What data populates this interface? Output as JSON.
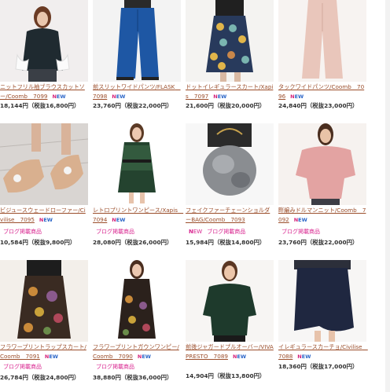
{
  "products": [
    {
      "name": "ニットフリル袖ブラウスカットソー/Coomb　7099",
      "new": "NEW",
      "blog": "",
      "price": "18,144円（税抜16,800円）"
    },
    {
      "name": "前スリットワイドパンツ/FLASK　7098",
      "new": "NEW",
      "blog": "",
      "price": "23,760円（税抜22,000円）"
    },
    {
      "name": "ドットイレギュラースカート/Xapis　7097",
      "new": "NEW",
      "blog": "",
      "price": "21,600円（税抜20,000円）"
    },
    {
      "name": "タックワイドパンツ/Coomb　7096",
      "new": "NEW",
      "blog": "",
      "price": "24,840円（税抜23,000円）"
    },
    {
      "name": "ビジュースウェードローファー/Civilise　7095",
      "new": "NEW",
      "blog": "ブログ掲載商品",
      "price": "10,584円（税抜9,800円）"
    },
    {
      "name": "レトロプリントワンピース/Xapis　7094",
      "new": "NEW",
      "blog": "ブログ掲載商品",
      "price": "28,080円（税抜26,000円）"
    },
    {
      "name": "フェイクファーチェーンショルダーBAG/Coomb　7093",
      "new": "NEW",
      "blog": "ブログ掲載商品",
      "price": "15,984円（税抜14,800円）"
    },
    {
      "name": "畔編みドルマンニット/Coomb　7092",
      "new": "NEW",
      "blog": "ブログ掲載商品",
      "price": "23,760円（税抜22,000円）"
    },
    {
      "name": "フラワープリントラップスカート/Coomb　7091",
      "new": "NEW",
      "blog": "ブログ掲載商品",
      "price": "26,784円（税抜24,800円）"
    },
    {
      "name": "フラワープリントガウンワンピー/Coomb　7090",
      "new": "NEW",
      "blog": "ブログ掲載商品",
      "price": "38,880円（税抜36,000円）"
    },
    {
      "name": "前後ジャガードプルオーバー/VIVA PRESTO　7089",
      "new": "NEW",
      "blog": "",
      "price": "14,904円（税抜13,800円）"
    },
    {
      "name": "イレギュラースカーチョ/Civilise　7088",
      "new": "NEW",
      "blog": "",
      "price": "18,360円（税抜17,000円）"
    }
  ],
  "colors": {
    "link": "#9b4e2b",
    "blog": "#d8238e",
    "price": "#333333",
    "new_blue": "#2b66c8",
    "new_pink": "#d4237a"
  }
}
